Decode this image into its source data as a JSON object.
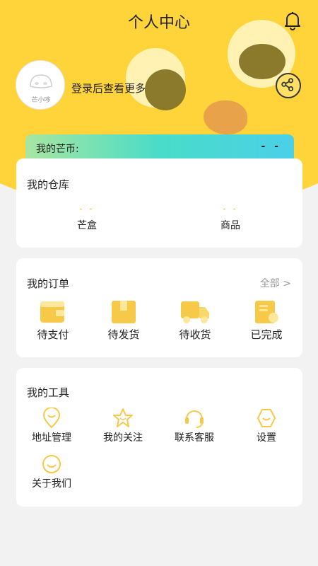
{
  "header": {
    "title": "个人中心"
  },
  "profile": {
    "avatar_label": "芒小哆",
    "login_prompt": "登录后查看更多"
  },
  "coins": {
    "label": "我的芒币:",
    "value": "- -"
  },
  "warehouse": {
    "title": "我的仓库",
    "items": [
      {
        "value": "- -",
        "label": "芒盒"
      },
      {
        "value": "- -",
        "label": "商品"
      }
    ]
  },
  "orders": {
    "title": "我的订单",
    "all_link": "全部 >",
    "items": [
      {
        "label": "待支付",
        "icon": "wallet-icon"
      },
      {
        "label": "待发货",
        "icon": "box-icon"
      },
      {
        "label": "待收货",
        "icon": "truck-icon"
      },
      {
        "label": "已完成",
        "icon": "completed-doc-icon"
      }
    ]
  },
  "tools": {
    "title": "我的工具",
    "items": [
      {
        "label": "地址管理",
        "icon": "location-pin-icon"
      },
      {
        "label": "我的关注",
        "icon": "star-icon"
      },
      {
        "label": "联系客服",
        "icon": "headset-icon"
      },
      {
        "label": "设置",
        "icon": "settings-hex-icon"
      },
      {
        "label": "关于我们",
        "icon": "smile-icon"
      }
    ]
  },
  "colors": {
    "accent": "#ffd43a",
    "icon_yellow": "#f7c948",
    "text": "#222222",
    "muted": "#999999"
  }
}
